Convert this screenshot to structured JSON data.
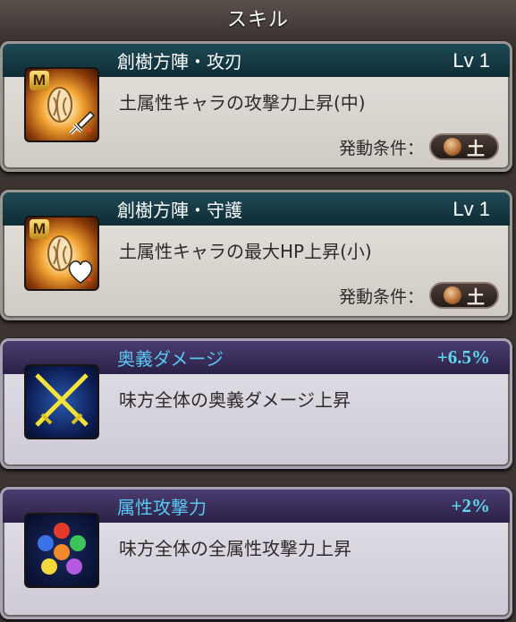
{
  "header": {
    "title": "スキル"
  },
  "skills": [
    {
      "name": "創樹方陣・攻刃",
      "level": "Lv 1",
      "description": "土属性キャラの攻撃力上昇(中)",
      "condition_label": "発動条件：",
      "element": "土",
      "icon_badge": "M",
      "icon": "sword-icon"
    },
    {
      "name": "創樹方陣・守護",
      "level": "Lv 1",
      "description": "土属性キャラの最大HP上昇(小)",
      "condition_label": "発動条件：",
      "element": "土",
      "icon_badge": "M",
      "icon": "heart-icon"
    }
  ],
  "bonuses": [
    {
      "name": "奥義ダメージ",
      "value": "+6.5%",
      "description": "味方全体の奥義ダメージ上昇",
      "icon": "crossed-swords-icon"
    },
    {
      "name": "属性攻撃力",
      "value": "+2%",
      "description": "味方全体の全属性攻撃力上昇",
      "icon": "element-orbs-icon"
    }
  ],
  "colors": {
    "skill_title_bar": "#1e4a56",
    "bonus_title_bar": "#4b3d70",
    "bonus_name": "#59c6f2",
    "bonus_value": "#5fd8f0"
  }
}
